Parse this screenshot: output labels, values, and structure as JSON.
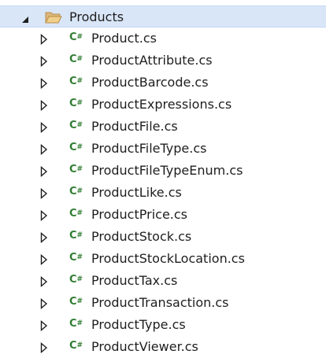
{
  "folder": {
    "label": "Products",
    "expanded": true,
    "icon": "folder-open-icon",
    "icon_color": "#dcb67a"
  },
  "csharp_icon_label": "C#",
  "csharp_icon_color": "#2f7d32",
  "selection_color": "#d9e6f8",
  "files": [
    {
      "label": "Product.cs"
    },
    {
      "label": "ProductAttribute.cs"
    },
    {
      "label": "ProductBarcode.cs"
    },
    {
      "label": "ProductExpressions.cs"
    },
    {
      "label": "ProductFile.cs"
    },
    {
      "label": "ProductFileType.cs"
    },
    {
      "label": "ProductFileTypeEnum.cs"
    },
    {
      "label": "ProductLike.cs"
    },
    {
      "label": "ProductPrice.cs"
    },
    {
      "label": "ProductStock.cs"
    },
    {
      "label": "ProductStockLocation.cs"
    },
    {
      "label": "ProductTax.cs"
    },
    {
      "label": "ProductTransaction.cs"
    },
    {
      "label": "ProductType.cs"
    },
    {
      "label": "ProductViewer.cs"
    }
  ]
}
